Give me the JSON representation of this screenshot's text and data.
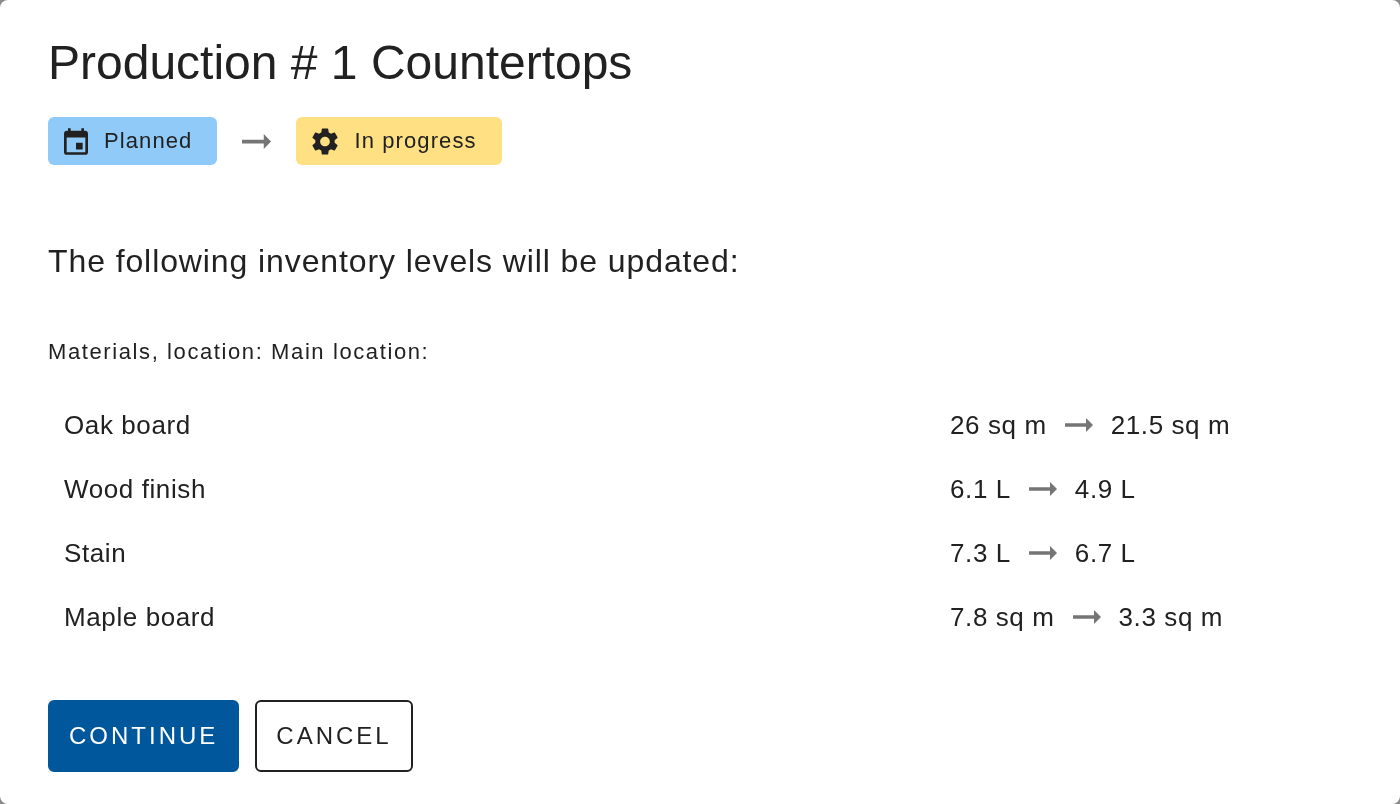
{
  "dialog": {
    "title": "Production # 1 Countertops"
  },
  "status_flow": [
    {
      "kind": "planned",
      "label": "Planned",
      "color": "#90caf9"
    },
    {
      "kind": "in_progress",
      "label": "In progress",
      "color": "#ffe082"
    }
  ],
  "message": "The following inventory levels will be updated:",
  "inventory_group": {
    "heading": "Materials, location: Main location:",
    "rows": [
      {
        "name": "Oak board",
        "from": "26 sq m",
        "to": "21.5 sq m"
      },
      {
        "name": "Wood finish",
        "from": "6.1 L",
        "to": "4.9 L"
      },
      {
        "name": "Stain",
        "from": "7.3 L",
        "to": "6.7 L"
      },
      {
        "name": "Maple board",
        "from": "7.8 sq m",
        "to": "3.3 sq m"
      }
    ]
  },
  "buttons": [
    {
      "kind": "primary",
      "label": "CONTINUE"
    },
    {
      "kind": "outlined",
      "label": "CANCEL"
    }
  ]
}
